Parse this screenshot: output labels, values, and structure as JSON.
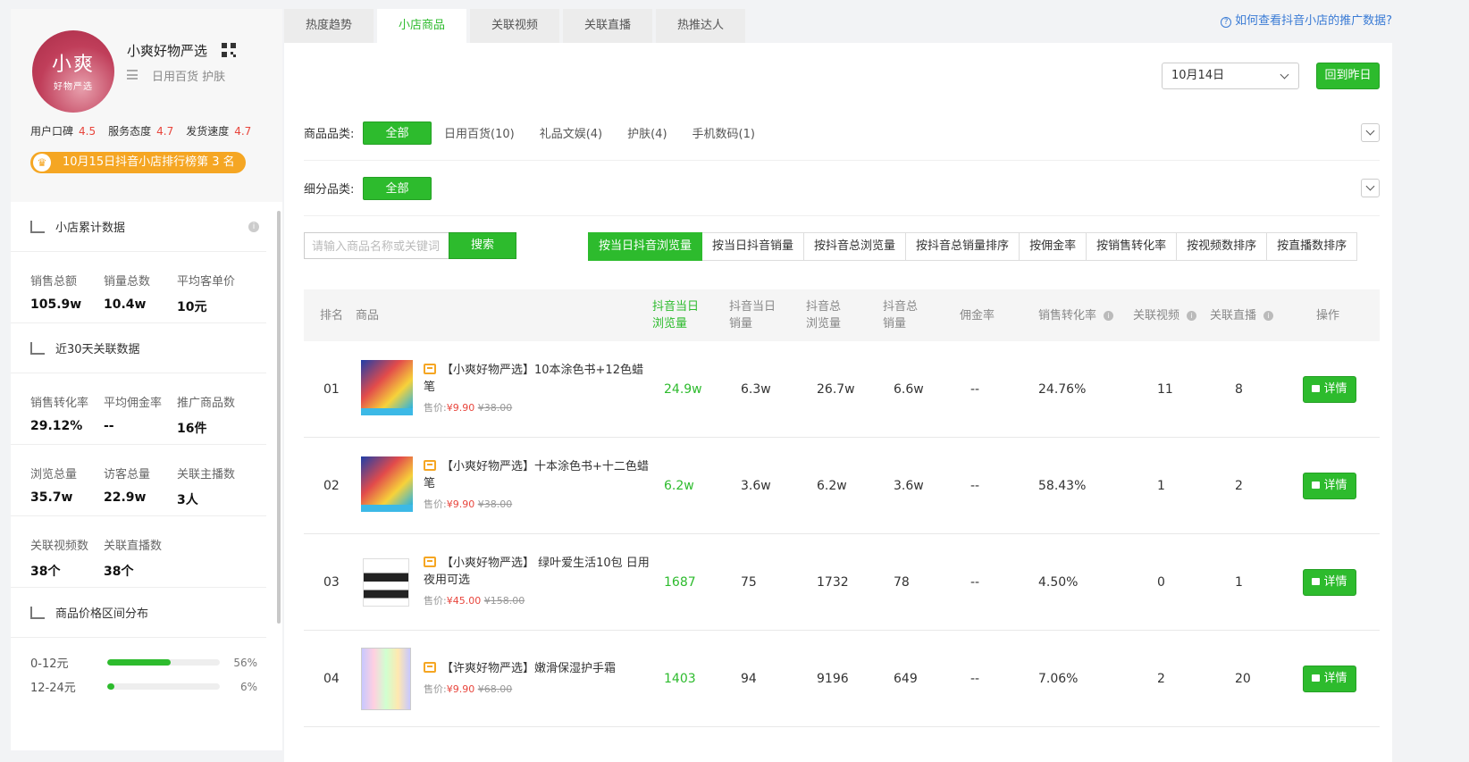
{
  "shop": {
    "avatar_line1": "小爽",
    "avatar_line2": "好物严选",
    "name": "小爽好物严选",
    "categories": "日用百货 护肤",
    "ratings": [
      {
        "label": "用户口碑",
        "value": "4.5"
      },
      {
        "label": "服务态度",
        "value": "4.7"
      },
      {
        "label": "发货速度",
        "value": "4.7"
      }
    ],
    "rank_badge": "10月15日抖音小店排行榜第 3 名"
  },
  "cumulative": {
    "title": "小店累计数据",
    "stats": [
      {
        "label": "销售总额",
        "value": "105.9w"
      },
      {
        "label": "销量总数",
        "value": "10.4w"
      },
      {
        "label": "平均客单价",
        "value": "10元"
      }
    ]
  },
  "last30": {
    "title": "近30天关联数据",
    "rows": [
      [
        {
          "label": "销售转化率",
          "value": "29.12%"
        },
        {
          "label": "平均佣金率",
          "value": "--"
        },
        {
          "label": "推广商品数",
          "value": "16件"
        }
      ],
      [
        {
          "label": "浏览总量",
          "value": "35.7w"
        },
        {
          "label": "访客总量",
          "value": "22.9w"
        },
        {
          "label": "关联主播数",
          "value": "3人"
        }
      ],
      [
        {
          "label": "关联视频数",
          "value": "38个"
        },
        {
          "label": "关联直播数",
          "value": "38个"
        }
      ]
    ]
  },
  "price_dist": {
    "title": "商品价格区间分布",
    "items": [
      {
        "range": "0-12元",
        "percent": 56,
        "label": "56%"
      },
      {
        "range": "12-24元",
        "percent": 6,
        "label": "6%"
      }
    ]
  },
  "tabs": [
    "热度趋势",
    "小店商品",
    "关联视频",
    "关联直播",
    "热推达人"
  ],
  "active_tab": 1,
  "help_link": "如何查看抖音小店的推广数据?",
  "date_select": "10月14日",
  "back_button": "回到昨日",
  "filters": {
    "category_label": "商品品类:",
    "category_all": "全部",
    "category_options": [
      "日用百货(10)",
      "礼品文娱(4)",
      "护肤(4)",
      "手机数码(1)"
    ],
    "sub_label": "细分品类:",
    "sub_all": "全部"
  },
  "search": {
    "placeholder": "请输入商品名称或关键词",
    "button": "搜索"
  },
  "sort_buttons": [
    "按当日抖音浏览量",
    "按当日抖音销量",
    "按抖音总浏览量",
    "按抖音总销量排序",
    "按佣金率",
    "按销售转化率",
    "按视频数排序",
    "按直播数排序"
  ],
  "table": {
    "headers": {
      "rank": "排名",
      "product": "商品",
      "day_views": "抖音当日浏览量",
      "day_sales": "抖音当日销量",
      "total_views": "抖音总浏览量",
      "total_sales": "抖音总销量",
      "commission": "佣金率",
      "conversion": "销售转化率",
      "videos": "关联视频",
      "lives": "关联直播",
      "action": "操作"
    },
    "price_label": "售价:",
    "detail_label": "详情",
    "rows": [
      {
        "rank": "01",
        "title": "【小爽好物严选】10本涂色书+12色蜡笔",
        "price": "¥9.90",
        "old_price": "¥38.00",
        "day_views": "24.9w",
        "day_sales": "6.3w",
        "total_views": "26.7w",
        "total_sales": "6.6w",
        "commission": "--",
        "conversion": "24.76%",
        "videos": "11",
        "lives": "8"
      },
      {
        "rank": "02",
        "title": "【小爽好物严选】十本涂色书+十二色蜡笔",
        "price": "¥9.90",
        "old_price": "¥38.00",
        "day_views": "6.2w",
        "day_sales": "3.6w",
        "total_views": "6.2w",
        "total_sales": "3.6w",
        "commission": "--",
        "conversion": "58.43%",
        "videos": "1",
        "lives": "2"
      },
      {
        "rank": "03",
        "title": "【小爽好物严选】 绿叶爱生活10包 日用夜用可选",
        "price": "¥45.00",
        "old_price": "¥158.00",
        "day_views": "1687",
        "day_sales": "75",
        "total_views": "1732",
        "total_sales": "78",
        "commission": "--",
        "conversion": "4.50%",
        "videos": "0",
        "lives": "1"
      },
      {
        "rank": "04",
        "title": "【许爽好物严选】嫩滑保湿护手霜",
        "price": "¥9.90",
        "old_price": "¥68.00",
        "day_views": "1403",
        "day_sales": "94",
        "total_views": "9196",
        "total_sales": "649",
        "commission": "--",
        "conversion": "7.06%",
        "videos": "2",
        "lives": "20"
      }
    ]
  },
  "colors": {
    "accent": "#2dbb2d",
    "price_red": "#e8453c",
    "badge": "#f5a623",
    "link": "#3a7bd5"
  }
}
